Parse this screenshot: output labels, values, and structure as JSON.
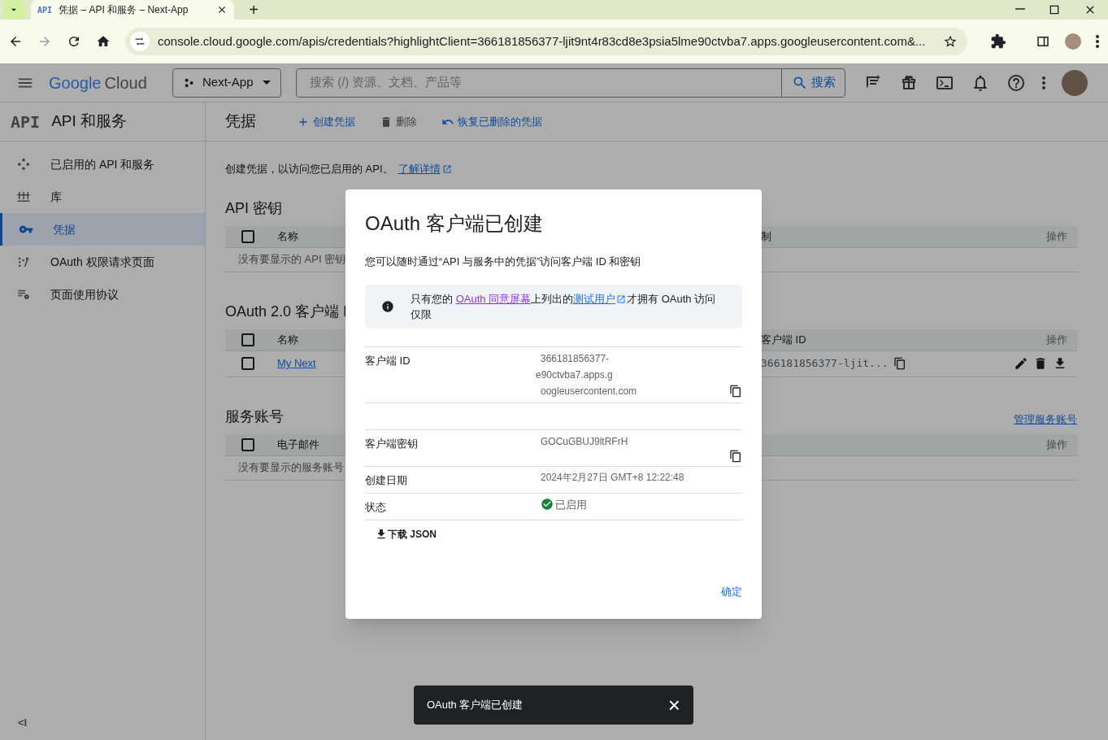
{
  "browser": {
    "tab_icon": "API",
    "tab_title": "凭据 – API 和服务 – Next-App",
    "new_tab": "+",
    "url": "console.cloud.google.com/apis/credentials?highlightClient=366181856377-ljit9nt4r83cd8e3psia5lme90ctvba7.apps.googleusercontent.com&..."
  },
  "header": {
    "logo_google": "Google",
    "logo_cloud": "Cloud",
    "project": "Next-App",
    "search_placeholder": "搜索 (/) 资源、文档、产品等",
    "search_button": "搜索"
  },
  "sidebar": {
    "badge": "API",
    "title": "API 和服务",
    "items": [
      {
        "label": "已启用的 API 和服务",
        "selected": false
      },
      {
        "label": "库",
        "selected": false
      },
      {
        "label": "凭据",
        "selected": true
      },
      {
        "label": "OAuth 权限请求页面",
        "selected": false
      },
      {
        "label": "页面使用协议",
        "selected": false
      }
    ],
    "collapse": "<I"
  },
  "toolbar": {
    "title": "凭据",
    "actions": [
      {
        "label": "创建凭据",
        "disabled": false
      },
      {
        "label": "删除",
        "disabled": true
      },
      {
        "label": "恢复已删除的凭据",
        "disabled": false
      }
    ]
  },
  "intro": {
    "text": "创建凭据，以访问您已启用的 API。",
    "link": "了解详情"
  },
  "sections": [
    {
      "title": "API 密钥",
      "select_all_checked": false,
      "columns": [
        "名称",
        "制",
        "操作"
      ],
      "empty": "没有要显示的 API 密钥"
    },
    {
      "title": "OAuth 2.0 客户端 I",
      "select_all_checked": false,
      "columns": [
        "名称",
        "客户端 ID",
        "操作"
      ],
      "rows": [
        {
          "checked": false,
          "name": "My Next",
          "client_id": "366181856377-ljit..."
        }
      ]
    },
    {
      "title": "服务账号",
      "link": "管理服务账号",
      "select_all_checked": false,
      "columns": [
        "电子邮件",
        "操作"
      ],
      "empty": "没有要显示的服务账号"
    }
  ],
  "dialog": {
    "title": "OAuth 客户端已创建",
    "description": "您可以随时通过“API 与服务中的凭据”访问客户端 ID 和密钥",
    "notice": {
      "before": "只有您的 ",
      "link1": "OAuth 同意屏幕",
      "middle": "上列出的",
      "link2": "测试用户",
      "after": "才拥有 OAuth 访问仅限"
    },
    "client_id": {
      "label": "客户端 ID",
      "line1": "366181856377-",
      "line2": "e90ctvba7.apps.g",
      "line3": "oogleusercontent.com"
    },
    "client_secret": {
      "label": "客户端密钥",
      "start": "GOC",
      "end": "uGBUJ9ltRFrH"
    },
    "created": {
      "label": "创建日期",
      "value": "2024年2月27日 GMT+8 12:22:48"
    },
    "status": {
      "label": "状态",
      "value": "已启用"
    },
    "download": "下载 JSON",
    "ok": "确定"
  },
  "snackbar": {
    "text": "OAuth 客户端已创建",
    "close": "×"
  }
}
